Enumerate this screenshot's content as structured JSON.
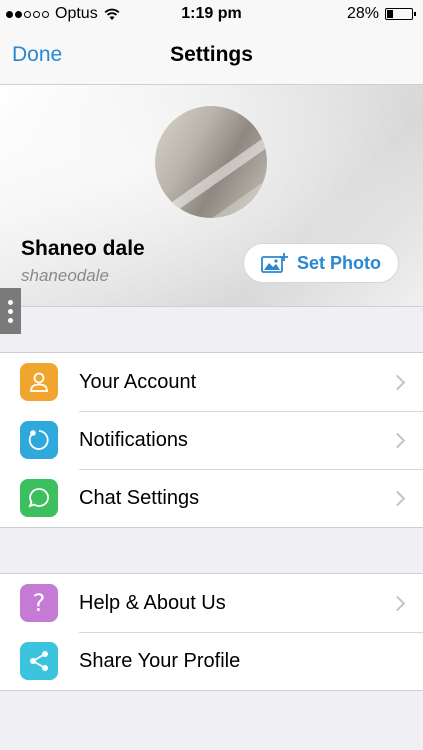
{
  "status_bar": {
    "carrier": "Optus",
    "time": "1:19 pm",
    "battery": "28%",
    "battery_level": 0.28,
    "signal_bars": 2
  },
  "nav": {
    "done_label": "Done",
    "title": "Settings"
  },
  "profile": {
    "name": "Shaneo dale",
    "username": "shaneodale",
    "set_photo_label": "Set Photo"
  },
  "menu_group_1": [
    {
      "label": "Your Account",
      "icon": "person-icon",
      "color": "#f0a52e"
    },
    {
      "label": "Notifications",
      "icon": "notification-icon",
      "color": "#2fa8de"
    },
    {
      "label": "Chat Settings",
      "icon": "chat-bubble-icon",
      "color": "#3cbf5e"
    }
  ],
  "menu_group_2": [
    {
      "label": "Help & About Us",
      "icon": "question-icon",
      "color": "#c57ad6"
    },
    {
      "label": "Share Your Profile",
      "icon": "share-icon",
      "color": "#3cc3dd"
    }
  ],
  "accent_color": "#2a87d0"
}
